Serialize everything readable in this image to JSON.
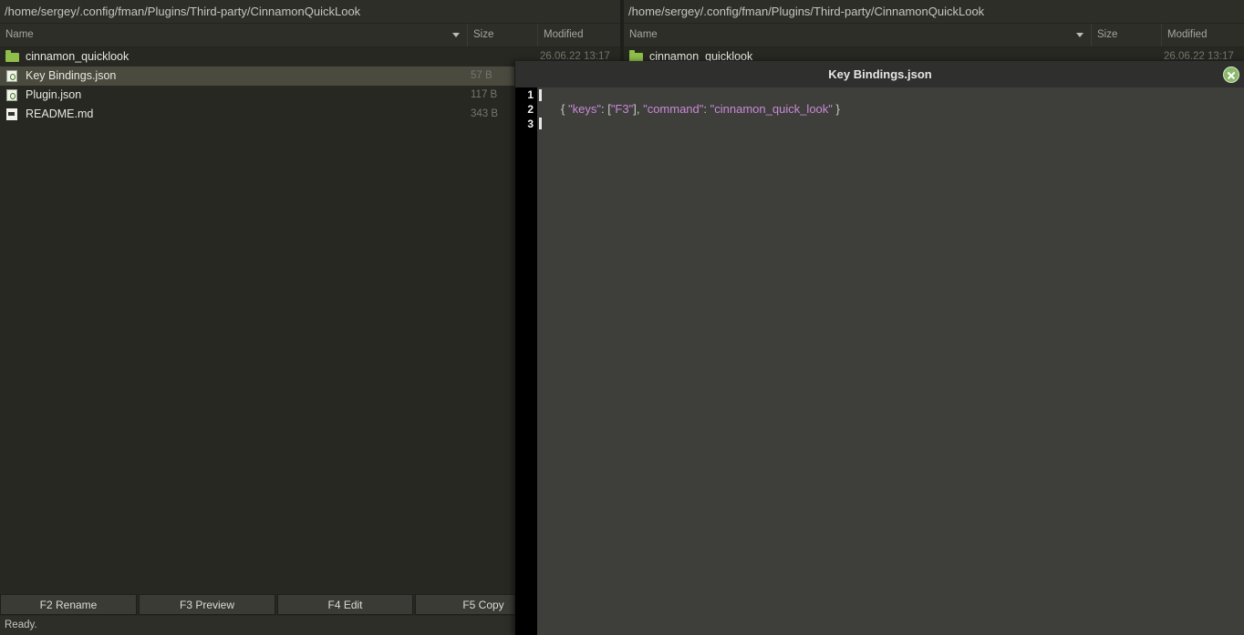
{
  "left_pane": {
    "path": "/home/sergey/.config/fman/Plugins/Third-party/CinnamonQuickLook",
    "columns": {
      "name": "Name",
      "size": "Size",
      "modified": "Modified"
    },
    "files": [
      {
        "name": "cinnamon_quicklook",
        "size": "",
        "modified": "26.06.22 13:17",
        "icon": "folder-icon"
      },
      {
        "name": "Key Bindings.json",
        "size": "57 B",
        "modified": "",
        "icon": "json-file-icon",
        "selected": true
      },
      {
        "name": "Plugin.json",
        "size": "117 B",
        "modified": "",
        "icon": "json-file-icon"
      },
      {
        "name": "README.md",
        "size": "343 B",
        "modified": "",
        "icon": "markdown-file-icon"
      }
    ]
  },
  "right_pane": {
    "path": "/home/sergey/.config/fman/Plugins/Third-party/CinnamonQuickLook",
    "columns": {
      "name": "Name",
      "size": "Size",
      "modified": "Modified"
    },
    "files": [
      {
        "name": "cinnamon_quicklook",
        "size": "",
        "modified": "26.06.22 13:17",
        "icon": "folder-icon"
      }
    ]
  },
  "buttons": {
    "rename": "F2 Rename",
    "preview": "F3 Preview",
    "edit": "F4 Edit",
    "copy": "F5 Copy"
  },
  "status": "Ready.",
  "preview": {
    "title": "Key Bindings.json",
    "line_numbers": [
      "1",
      "2",
      "3"
    ],
    "code": {
      "open_brace": "{",
      "keys_key": "\"keys\"",
      "colon1": ":",
      "bracket_open": "[",
      "f3": "\"F3\"",
      "bracket_close": "],",
      "command_key": "\"command\"",
      "colon2": ":",
      "command_val": "\"cinnamon_quick_look\"",
      "close_brace": "}"
    }
  },
  "colors": {
    "background": "#272822",
    "selection": "#4a4a3f",
    "folder": "#8fbf4a",
    "string": "#c98ad6",
    "close_button": "#8bb86a"
  }
}
